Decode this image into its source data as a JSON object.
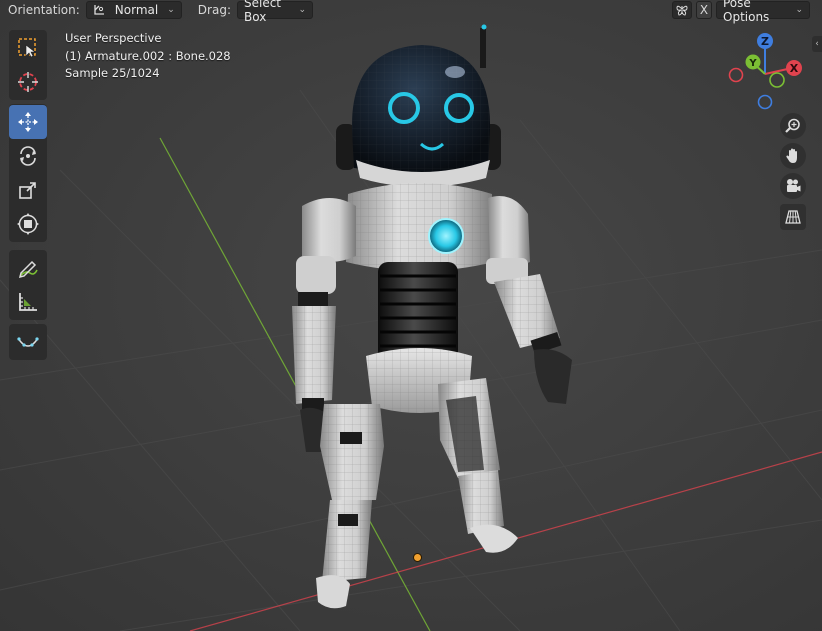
{
  "header": {
    "orientation_label": "Orientation:",
    "orientation_value": "Normal",
    "drag_label": "Drag:",
    "drag_value": "Select Box",
    "x_axis_label": "X",
    "pose_options_label": "Pose Options"
  },
  "overlay": {
    "view_name": "User Perspective",
    "active_bone": "(1) Armature.002 : Bone.028",
    "render_samples": "Sample 25/1024"
  },
  "gizmo": {
    "z_label": "Z",
    "y_label": "Y",
    "x_label": "X"
  },
  "toolbar": {
    "tools": [
      {
        "name": "select-box",
        "icon": "select-box-icon",
        "active": false
      },
      {
        "name": "cursor",
        "icon": "cursor-icon",
        "active": false
      },
      {
        "name": "move",
        "icon": "move-icon",
        "active": true
      },
      {
        "name": "rotate",
        "icon": "rotate-icon",
        "active": false
      },
      {
        "name": "scale",
        "icon": "scale-icon",
        "active": false
      },
      {
        "name": "transform",
        "icon": "transform-icon",
        "active": false
      },
      {
        "name": "annotate",
        "icon": "annotate-icon",
        "active": false
      },
      {
        "name": "measure",
        "icon": "measure-icon",
        "active": false
      },
      {
        "name": "relax",
        "icon": "curve-icon",
        "active": false
      }
    ]
  },
  "nav": [
    "zoom-icon",
    "hand-icon",
    "camera-icon",
    "grid-icon"
  ],
  "colors": {
    "active_tool": "#4772b3",
    "x_axis": "#e0434e",
    "y_axis": "#7bbf34",
    "z_axis": "#3f7ee0",
    "eye_glow": "#28c8e6",
    "origin": "#f0a030"
  }
}
